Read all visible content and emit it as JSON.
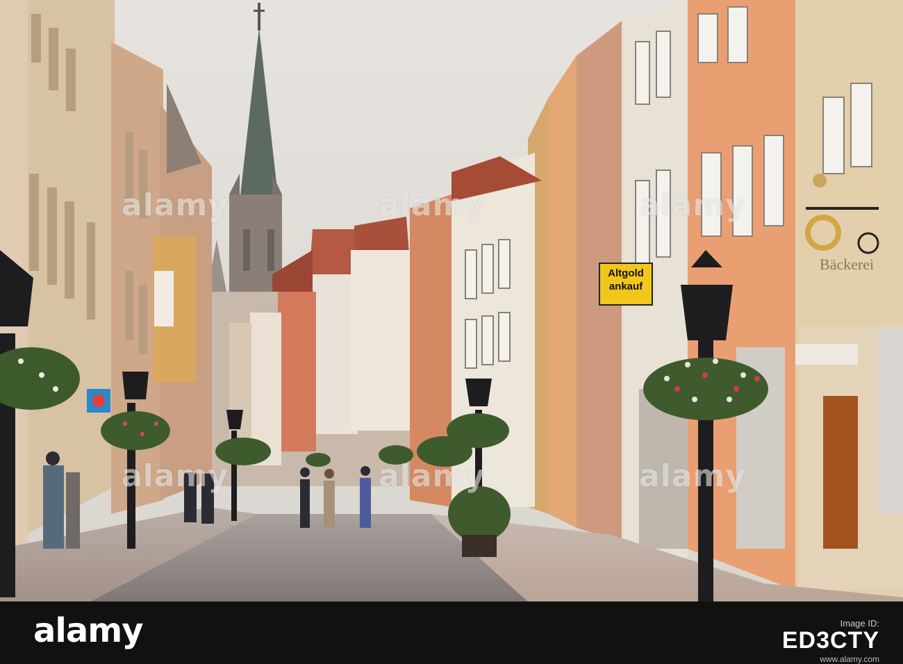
{
  "photo": {
    "description_tag": "street-scene",
    "signs": {
      "gold_sign_line1": "Altgold",
      "gold_sign_line2": "ankauf",
      "bakery_sign": "Bäckerei"
    }
  },
  "watermark": {
    "text": "alamy",
    "repeat": 6
  },
  "footer": {
    "logo_text": "alamy",
    "image_id_label": "Image ID:",
    "image_id": "ED3CTY",
    "footer_url": "www.alamy.com"
  },
  "colors": {
    "sky": "#e9e6e1",
    "bar": "#111111",
    "sign_yellow": "#f2c71b"
  }
}
